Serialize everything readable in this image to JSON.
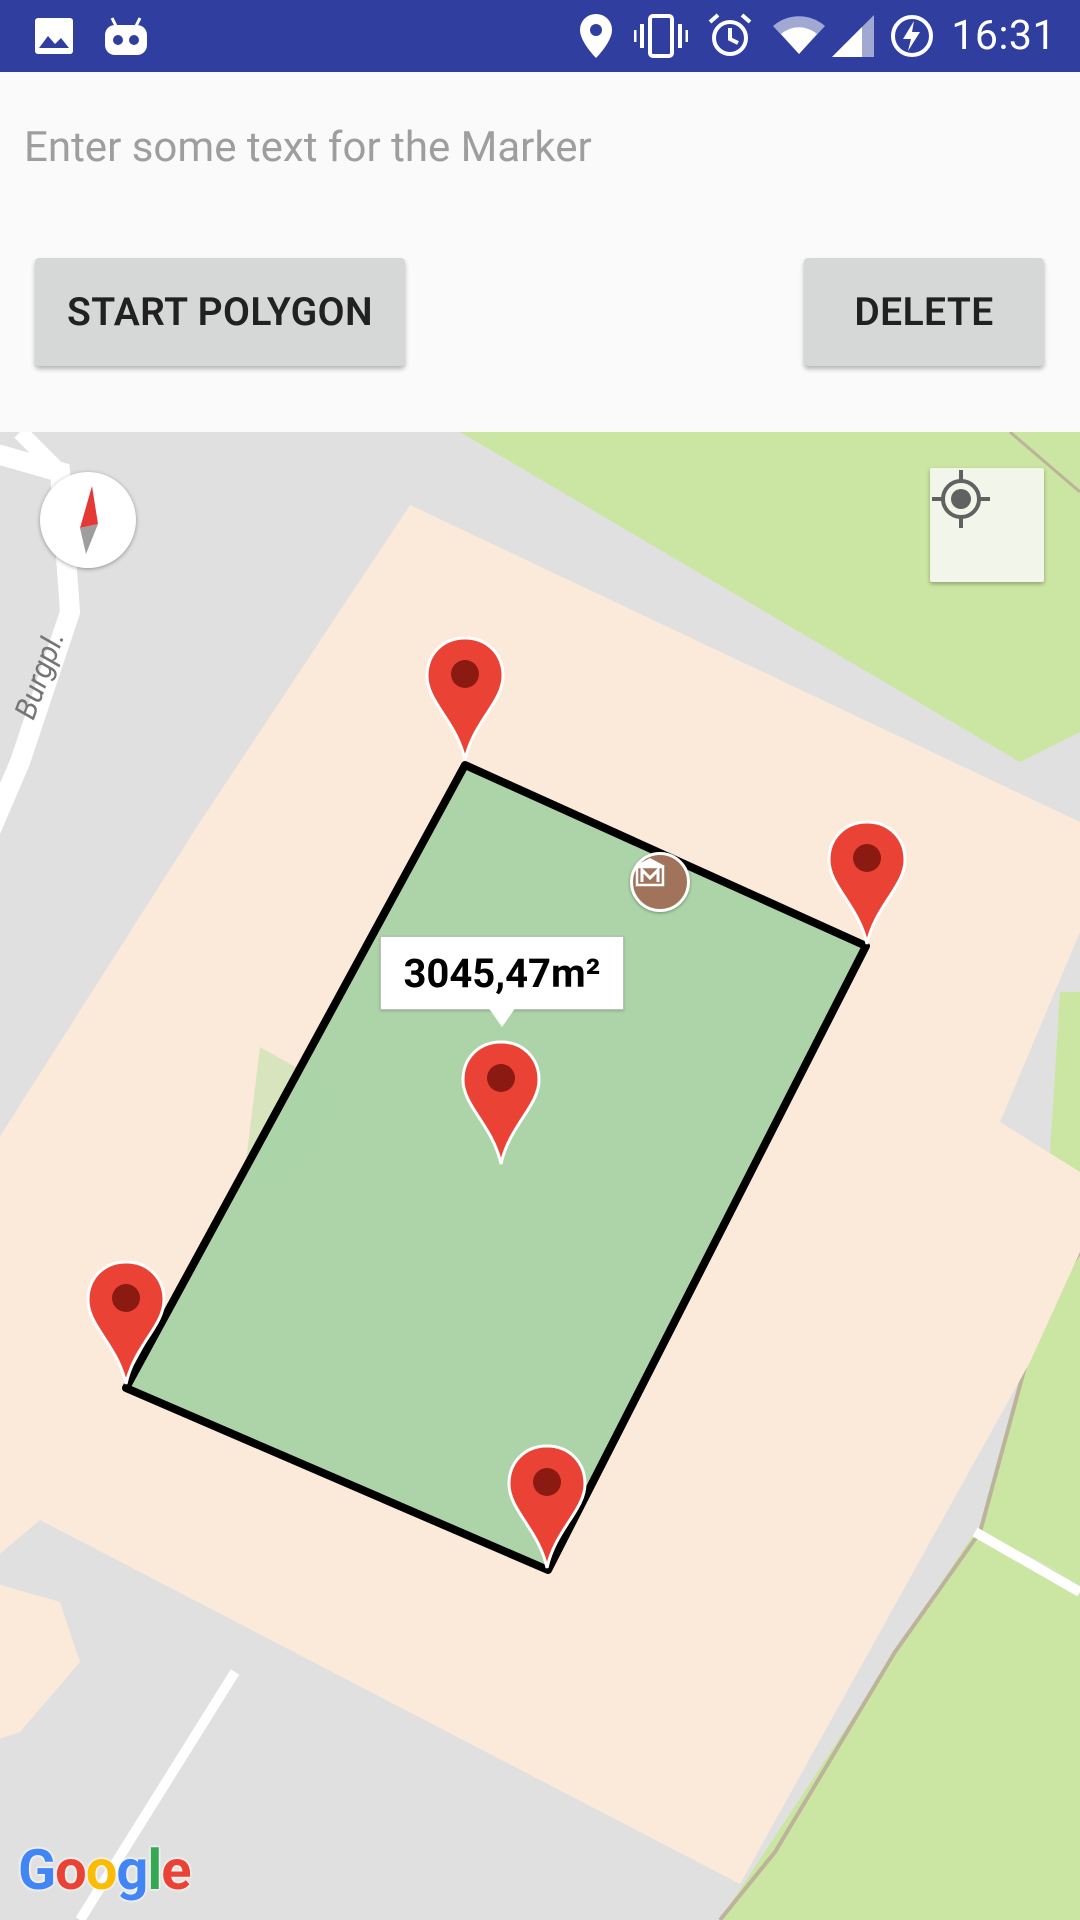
{
  "status_bar": {
    "time": "16:31",
    "icons": [
      "image-icon",
      "android-debug-icon",
      "location-icon",
      "vibrate-icon",
      "alarm-icon",
      "wifi-icon",
      "signal-icon",
      "battery-charging-icon"
    ]
  },
  "input": {
    "placeholder": "Enter some text for the Marker",
    "value": ""
  },
  "buttons": {
    "start_polygon": "START POLYGON",
    "delete": "DELETE"
  },
  "map": {
    "street_label": "Burgpl.",
    "info_window_text": "3045,47m²",
    "attribution": "Google",
    "markers": [
      "corner-top",
      "corner-right",
      "corner-bottom",
      "corner-left",
      "center"
    ],
    "poi_icon": "museum-icon",
    "colors": {
      "polygon_fill": "#a9d3a6",
      "polygon_stroke": "#000000",
      "marker_red": "#ea4335",
      "building_area": "#fbeada",
      "park": "#cbe6a3",
      "road": "#e0e0e0"
    }
  }
}
